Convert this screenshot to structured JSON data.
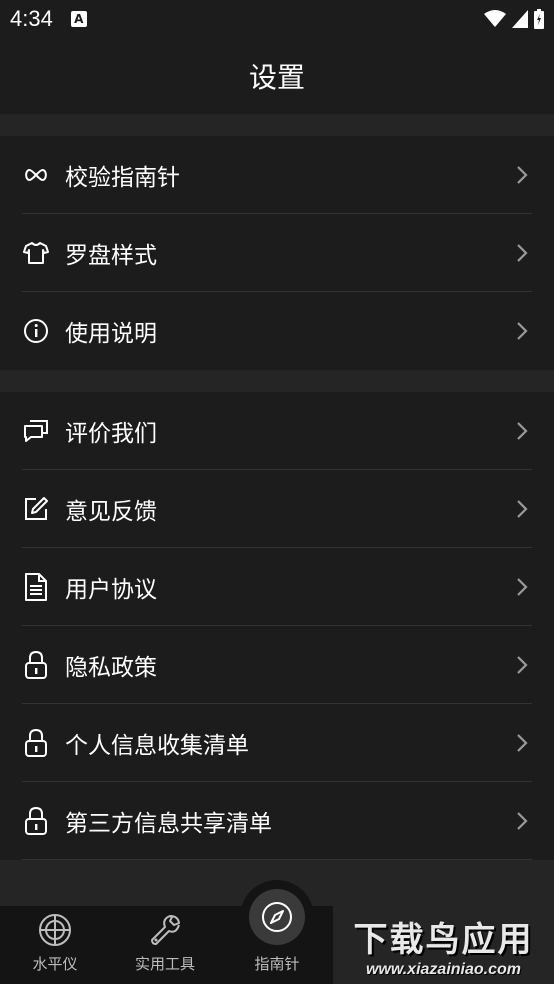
{
  "status_bar": {
    "time": "4:34",
    "a_icon": "A"
  },
  "header": {
    "title": "设置"
  },
  "group1": [
    {
      "icon": "infinity-icon",
      "label": "校验指南针"
    },
    {
      "icon": "shirt-icon",
      "label": "罗盘样式"
    },
    {
      "icon": "info-icon",
      "label": "使用说明"
    }
  ],
  "group2": [
    {
      "icon": "comment-icon",
      "label": "评价我们"
    },
    {
      "icon": "edit-icon",
      "label": "意见反馈"
    },
    {
      "icon": "document-icon",
      "label": "用户协议"
    },
    {
      "icon": "lock-icon",
      "label": "隐私政策"
    },
    {
      "icon": "lock-icon",
      "label": "个人信息收集清单"
    },
    {
      "icon": "lock-icon",
      "label": "第三方信息共享清单"
    }
  ],
  "tabbar": {
    "level": "水平仪",
    "tools": "实用工具",
    "compass": "指南针"
  },
  "watermark": {
    "title": "下载鸟应用",
    "url": "www.xiazainiao.com"
  },
  "colors": {
    "background": "#1c1c1c",
    "section_gap": "#252525",
    "tabbar": "#141414"
  }
}
